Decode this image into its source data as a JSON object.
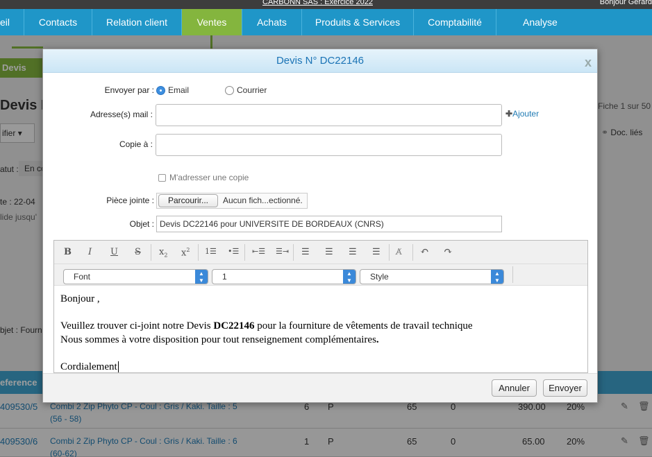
{
  "topbar": {
    "company": "CARBONN SAS : Exercice 2022",
    "greeting": "Bonjour Gerard"
  },
  "nav": {
    "items": [
      "eil",
      "Contacts",
      "Relation client",
      "Ventes",
      "Achats",
      "Produits & Services",
      "Comptabilité",
      "Analyse"
    ],
    "active": "Ventes"
  },
  "background": {
    "devis_tab": "Devis",
    "title": "Devis N",
    "fiche": "Fiche 1 sur 50",
    "modifier": "ifier",
    "docs_lies": "Doc. liés",
    "statut_label": "atut :",
    "statut_value": "En co",
    "date": "te : 22-04",
    "valide": "lide jusqu'",
    "objet": "bjet : Fourn",
    "reference_header": "eference",
    "rows": [
      {
        "ref": "409530/5",
        "desc1": "Combi 2 Zip Phyto CP - Coul : Gris / Kaki. Taille : 5",
        "desc2": "(56 - 58)",
        "qty": "6",
        "unit": "P",
        "pu": "65",
        "rem": "0",
        "total": "390.00",
        "tva": "20%"
      },
      {
        "ref": "409530/6",
        "desc1": "Combi 2 Zip Phyto CP - Coul : Gris / Kaki. Taille : 6",
        "desc2": "(60-62)",
        "qty": "1",
        "unit": "P",
        "pu": "65",
        "rem": "0",
        "total": "65.00",
        "tva": "20%"
      }
    ]
  },
  "modal": {
    "title": "Devis N° DC22146",
    "close": "x",
    "envoyer_par_label": "Envoyer par :",
    "radio_email": "Email",
    "radio_courrier": "Courrier",
    "adresse_label": "Adresse(s) mail :",
    "adresse_value": "",
    "ajouter": "Ajouter",
    "copie_label": "Copie à :",
    "copie_value": "",
    "m_adresser": "M'adresser une copie",
    "piece_label": "Pièce jointe :",
    "parcourir": "Parcourir...",
    "no_file": "Aucun fich...ectionné.",
    "objet_label": "Objet :",
    "objet_value": "Devis  DC22146 pour UNIVERSITE DE BORDEAUX (CNRS)",
    "font_select": "Font",
    "size_select": "1",
    "style_select": "Style",
    "body": {
      "greeting": "Bonjour ,",
      "line1_pre": "Veuillez trouver ci-joint notre Devis ",
      "line1_bold": "DC22146",
      "line1_post": " pour la fourniture de vêtements de travail technique",
      "line2": "Nous sommes à votre disposition pour tout renseignement complémentaires",
      "line2_end": ".",
      "closing": "Cordialement"
    },
    "annuler": "Annuler",
    "envoyer": "Envoyer"
  }
}
